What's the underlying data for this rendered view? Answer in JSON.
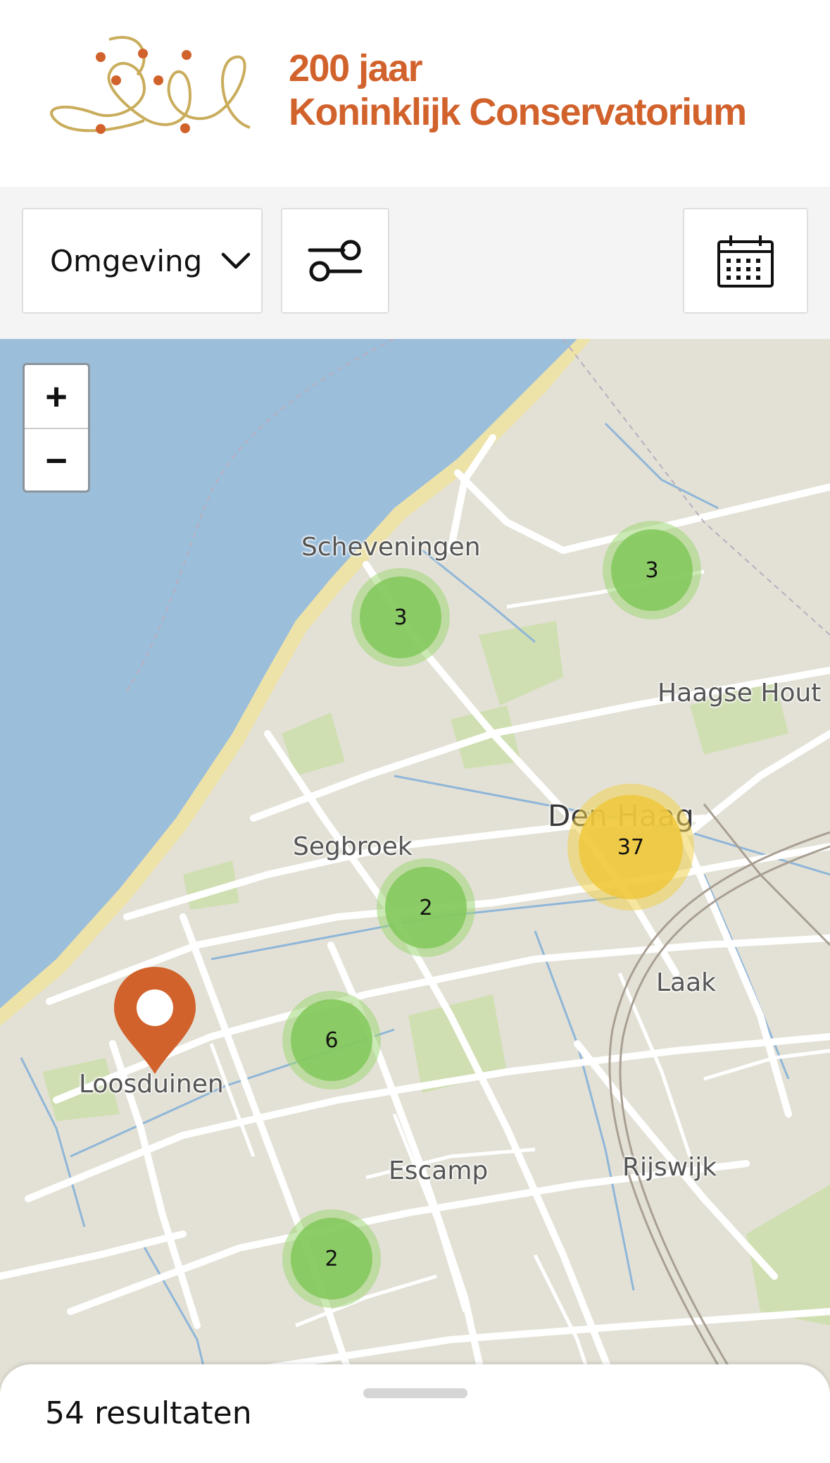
{
  "header": {
    "logo_line1": "200 jaar",
    "logo_line2": "Koninklijk Conservatorium"
  },
  "toolbar": {
    "select_value": "Omgeving",
    "filter_icon": "sliders-icon",
    "calendar_icon": "calendar-icon"
  },
  "map": {
    "zoom_in": "+",
    "zoom_out": "−",
    "places": {
      "scheveningen": "Scheveningen",
      "haagse_hout": "Haagse Hout",
      "den_haag": "Den Haag",
      "segbroek": "Segbroek",
      "laak": "Laak",
      "loosduinen": "Loosduinen",
      "escamp": "Escamp",
      "rijswijk": "Rijswijk"
    },
    "clusters": {
      "scheveningen": "3",
      "northeast": "3",
      "den_haag": "37",
      "segbroek": "2",
      "west": "6",
      "south": "2"
    },
    "colors": {
      "water": "#9bbedb",
      "land": "#e3e1d6",
      "cluster_green": "#82c85a",
      "cluster_yellow": "#f0c83c",
      "pin": "#d2622c"
    }
  },
  "results": {
    "count_label": "54 resultaten"
  }
}
